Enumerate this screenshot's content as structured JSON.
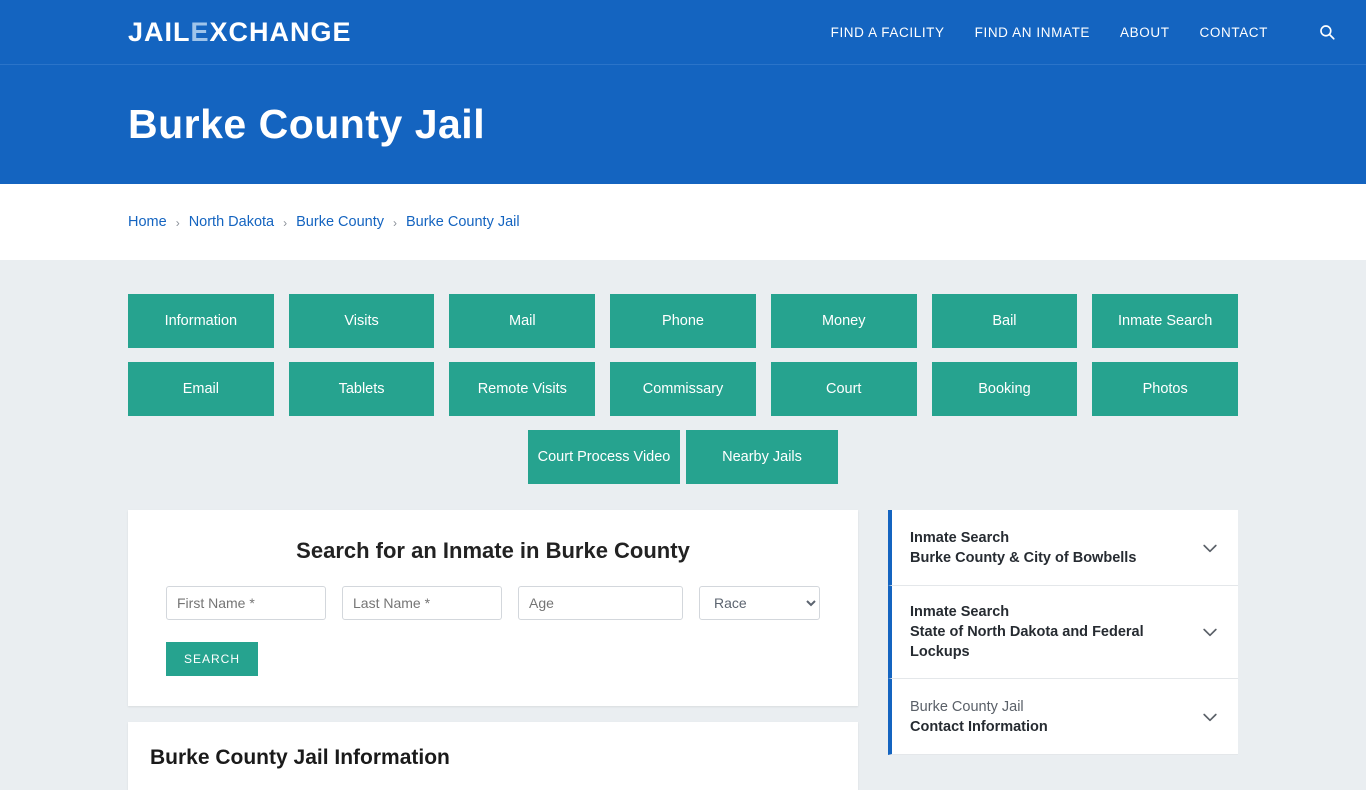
{
  "header": {
    "logo_part1": "JAIL",
    "logo_x": "E",
    "logo_part2": "XCHANGE",
    "nav": [
      {
        "label": "FIND A FACILITY"
      },
      {
        "label": "FIND AN INMATE"
      },
      {
        "label": "ABOUT"
      },
      {
        "label": "CONTACT"
      }
    ],
    "search_icon": "search-icon"
  },
  "hero": {
    "title": "Burke County Jail"
  },
  "breadcrumb": {
    "items": [
      {
        "label": "Home"
      },
      {
        "label": "North Dakota"
      },
      {
        "label": "Burke County"
      },
      {
        "label": "Burke County Jail"
      }
    ],
    "separator": "›"
  },
  "tabs": {
    "row1": [
      {
        "label": "Information"
      },
      {
        "label": "Visits"
      },
      {
        "label": "Mail"
      },
      {
        "label": "Phone"
      },
      {
        "label": "Money"
      },
      {
        "label": "Bail"
      },
      {
        "label": "Inmate Search"
      }
    ],
    "row2": [
      {
        "label": "Email"
      },
      {
        "label": "Tablets"
      },
      {
        "label": "Remote Visits"
      },
      {
        "label": "Commissary"
      },
      {
        "label": "Court"
      },
      {
        "label": "Booking"
      },
      {
        "label": "Photos"
      }
    ],
    "row3": [
      {
        "label": "Court Process Video"
      },
      {
        "label": "Nearby Jails"
      }
    ]
  },
  "search_card": {
    "title": "Search for an Inmate in Burke County",
    "first_name_placeholder": "First Name *",
    "last_name_placeholder": "Last Name *",
    "age_placeholder": "Age",
    "race_selected": "Race",
    "race_options": [
      "Race"
    ],
    "submit_label": "SEARCH"
  },
  "info_card": {
    "title": "Burke County Jail Information"
  },
  "sidebar": {
    "items": [
      {
        "line1": "Inmate Search",
        "line2": "Burke County & City of Bowbells",
        "line1_muted": false,
        "icon": "chevron-down-icon"
      },
      {
        "line1": "Inmate Search",
        "line2": "State of North Dakota and Federal Lockups",
        "line1_muted": false,
        "icon": "chevron-down-icon"
      },
      {
        "line1": "Burke County Jail",
        "line2": "Contact Information",
        "line1_muted": true,
        "icon": "chevron-down-icon"
      }
    ]
  },
  "colors": {
    "brand_blue": "#1464c0",
    "teal": "#26a38f",
    "page_grey": "#eaeef1"
  }
}
